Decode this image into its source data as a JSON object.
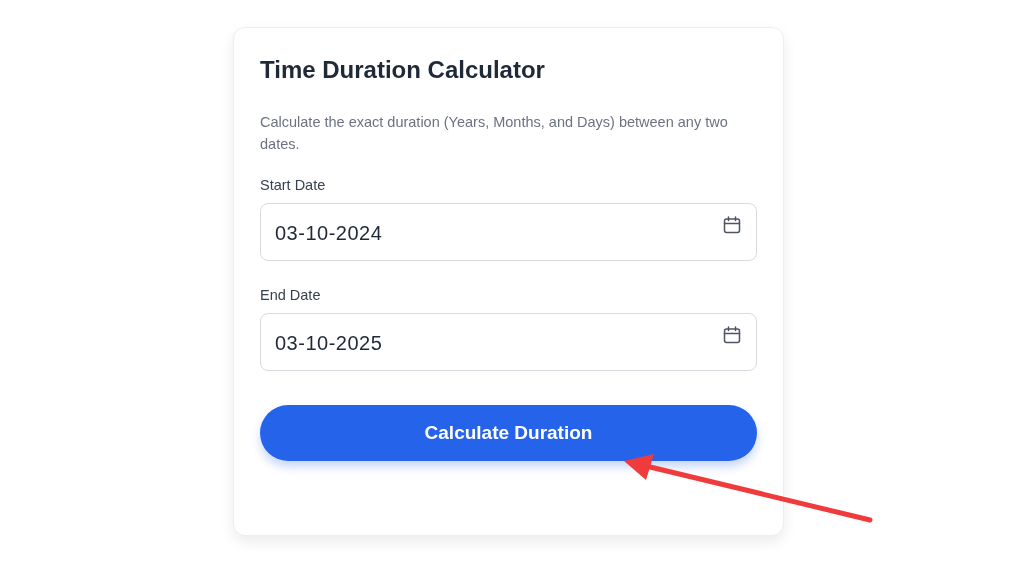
{
  "card": {
    "title": "Time Duration Calculator",
    "description": "Calculate the exact duration (Years, Months, and Days) between any two dates.",
    "fields": [
      {
        "label": "Start Date",
        "value": "03-10-2024"
      },
      {
        "label": "End Date",
        "value": "03-10-2025"
      }
    ],
    "button": "Calculate Duration"
  }
}
